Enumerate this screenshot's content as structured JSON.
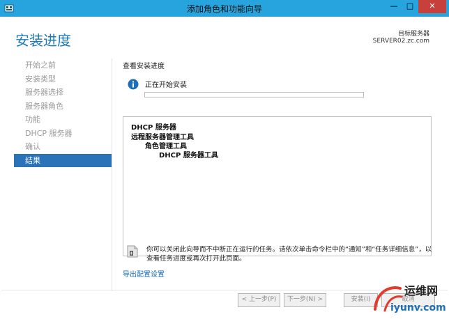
{
  "window": {
    "title": "添加角色和功能向导",
    "controls": {
      "minimize": "—",
      "maximize": "□",
      "close": "✕"
    }
  },
  "header": {
    "page_title": "安装进度",
    "destination_label": "目标服务器",
    "destination_server": "SERVER02.zc.com"
  },
  "nav": {
    "items": [
      {
        "label": "开始之前",
        "active": false
      },
      {
        "label": "安装类型",
        "active": false
      },
      {
        "label": "服务器选择",
        "active": false
      },
      {
        "label": "服务器角色",
        "active": false
      },
      {
        "label": "功能",
        "active": false
      },
      {
        "label": "DHCP 服务器",
        "active": false
      },
      {
        "label": "确认",
        "active": false
      },
      {
        "label": "结果",
        "active": true
      }
    ]
  },
  "main": {
    "heading": "查看安装进度",
    "status_text": "正在开始安装",
    "progress_percent": 0,
    "results": [
      {
        "label": "DHCP 服务器",
        "level": 0
      },
      {
        "label": "远程服务器管理工具",
        "level": 0
      },
      {
        "label": "角色管理工具",
        "level": 1
      },
      {
        "label": "DHCP 服务器工具",
        "level": 2
      }
    ],
    "note": "你可以关闭此向导而不中断正在运行的任务。请依次单击命令栏中的“通知”和“任务详细信息”，以查看任务进度或再次打开此页面。",
    "export_link": "导出配置设置"
  },
  "footer": {
    "prev_label": "< 上一步(P)",
    "next_label": "下一步(N) >",
    "install_label": "安装(I)",
    "cancel_label": "取消"
  },
  "watermark": {
    "line1": "运维网",
    "line2": "iyunv.com"
  },
  "colors": {
    "titlebar": "#27a3dd",
    "accent": "#1e7ab7",
    "nav_active": "#2a73b8",
    "close_button": "#c7413a"
  }
}
